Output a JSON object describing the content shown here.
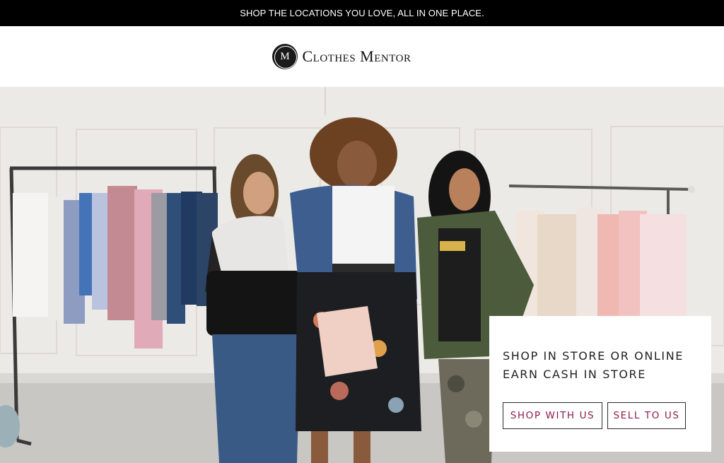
{
  "announcement": {
    "text": "SHOP THE LOCATIONS YOU LOVE, ALL IN ONE PLACE."
  },
  "brand": {
    "monogram": "M",
    "name": "Clothes Mentor"
  },
  "promo": {
    "line1": "SHOP IN STORE OR ONLINE",
    "line2": "EARN CASH IN STORE",
    "shop_button": "SHOP WITH US",
    "sell_button": "SELL TO US"
  },
  "colors": {
    "accent": "#8e1b4a",
    "topbar": "#000000"
  }
}
